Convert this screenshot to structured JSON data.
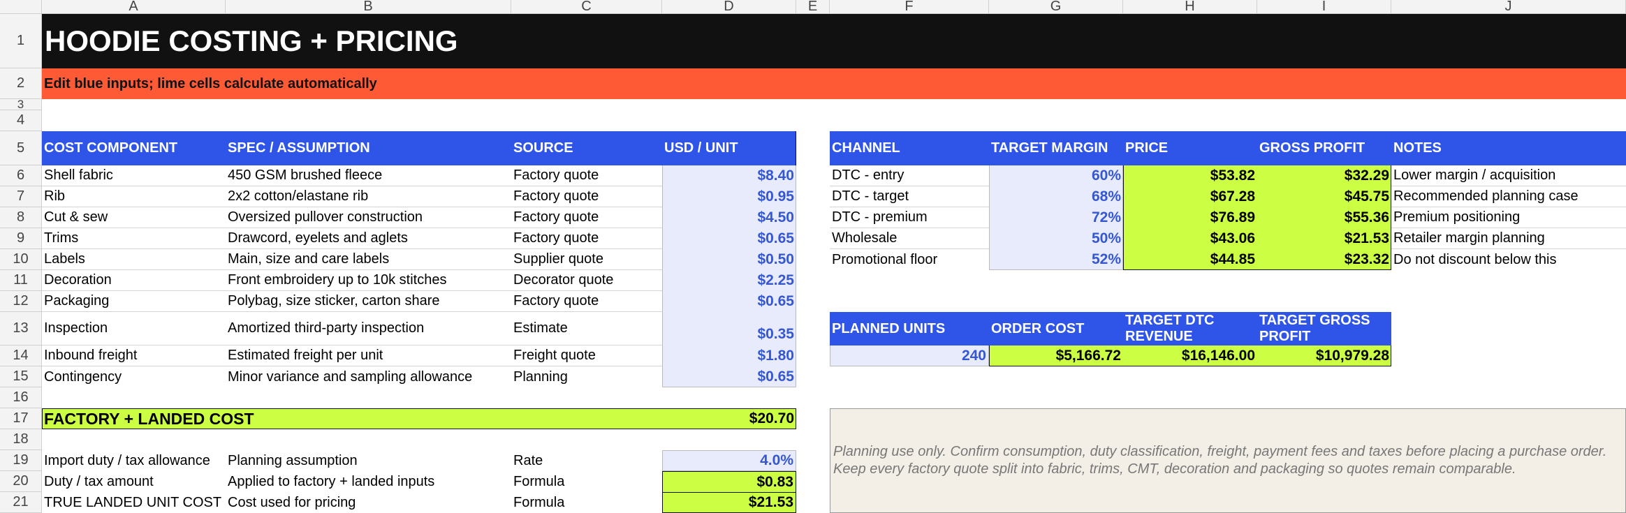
{
  "columns": [
    "A",
    "B",
    "C",
    "D",
    "E",
    "F",
    "G",
    "H",
    "I",
    "J"
  ],
  "rows": [
    "1",
    "2",
    "3",
    "4",
    "5",
    "6",
    "7",
    "8",
    "9",
    "10",
    "11",
    "12",
    "13",
    "14",
    "15",
    "16",
    "17",
    "18",
    "19",
    "20",
    "21"
  ],
  "title": "HOODIE COSTING + PRICING",
  "subtitle": "Edit blue inputs; lime cells calculate automatically",
  "cost_table": {
    "headers": [
      "COST COMPONENT",
      "SPEC / ASSUMPTION",
      "SOURCE",
      "USD / UNIT"
    ],
    "rows": [
      {
        "component": "Shell fabric",
        "spec": "450 GSM brushed fleece",
        "source": "Factory quote",
        "usd": "$8.40"
      },
      {
        "component": "Rib",
        "spec": "2x2 cotton/elastane rib",
        "source": "Factory quote",
        "usd": "$0.95"
      },
      {
        "component": "Cut & sew",
        "spec": "Oversized pullover construction",
        "source": "Factory quote",
        "usd": "$4.50"
      },
      {
        "component": "Trims",
        "spec": "Drawcord, eyelets and aglets",
        "source": "Factory quote",
        "usd": "$0.65"
      },
      {
        "component": "Labels",
        "spec": "Main, size and care labels",
        "source": "Supplier quote",
        "usd": "$0.50"
      },
      {
        "component": "Decoration",
        "spec": "Front embroidery up to 10k stitches",
        "source": "Decorator quote",
        "usd": "$2.25"
      },
      {
        "component": "Packaging",
        "spec": "Polybag, size sticker, carton share",
        "source": "Factory quote",
        "usd": "$0.65"
      },
      {
        "component": "Inspection",
        "spec": "Amortized third-party inspection",
        "source": "Estimate",
        "usd": "$0.35"
      },
      {
        "component": "Inbound freight",
        "spec": "Estimated freight per unit",
        "source": "Freight quote",
        "usd": "$1.80"
      },
      {
        "component": "Contingency",
        "spec": "Minor variance and sampling allowance",
        "source": "Planning",
        "usd": "$0.65"
      }
    ],
    "total_label": "FACTORY + LANDED COST",
    "total_value": "$20.70",
    "duty_rows": [
      {
        "label": "Import duty / tax allowance",
        "spec": "Planning assumption",
        "source": "Rate",
        "value": "4.0%"
      },
      {
        "label": "Duty / tax amount",
        "spec": "Applied to factory + landed inputs",
        "source": "Formula",
        "value": "$0.83"
      },
      {
        "label": "TRUE LANDED UNIT COST",
        "spec": "Cost used for pricing",
        "source": "Formula",
        "value": "$21.53"
      }
    ]
  },
  "channel_table": {
    "headers": [
      "CHANNEL",
      "TARGET MARGIN",
      "PRICE",
      "GROSS PROFIT",
      "NOTES"
    ],
    "rows": [
      {
        "channel": "DTC - entry",
        "margin": "60%",
        "price": "$53.82",
        "profit": "$32.29",
        "notes": "Lower margin / acquisition"
      },
      {
        "channel": "DTC - target",
        "margin": "68%",
        "price": "$67.28",
        "profit": "$45.75",
        "notes": "Recommended planning case"
      },
      {
        "channel": "DTC - premium",
        "margin": "72%",
        "price": "$76.89",
        "profit": "$55.36",
        "notes": "Premium positioning"
      },
      {
        "channel": "Wholesale",
        "margin": "50%",
        "price": "$43.06",
        "profit": "$21.53",
        "notes": "Retailer margin planning"
      },
      {
        "channel": "Promotional floor",
        "margin": "52%",
        "price": "$44.85",
        "profit": "$23.32",
        "notes": "Do not discount below this"
      }
    ]
  },
  "order_table": {
    "headers": [
      "PLANNED UNITS",
      "ORDER COST",
      "TARGET DTC REVENUE",
      "TARGET GROSS PROFIT"
    ],
    "values": [
      "240",
      "$5,166.72",
      "$16,146.00",
      "$10,979.28"
    ]
  },
  "note": "Planning use only. Confirm consumption, duty classification, freight, payment fees and taxes before placing a purchase order. Keep every factory quote split into fabric, trims, CMT, decoration and packaging so quotes remain comparable.",
  "colors": {
    "title_bg": "#111111",
    "banner_bg": "#ff5a36",
    "header_blue": "#2f55e8",
    "input_blue": "#e8ebfb",
    "input_text": "#3557d1",
    "lime": "#ccff44",
    "note_bg": "#f3efe7"
  }
}
